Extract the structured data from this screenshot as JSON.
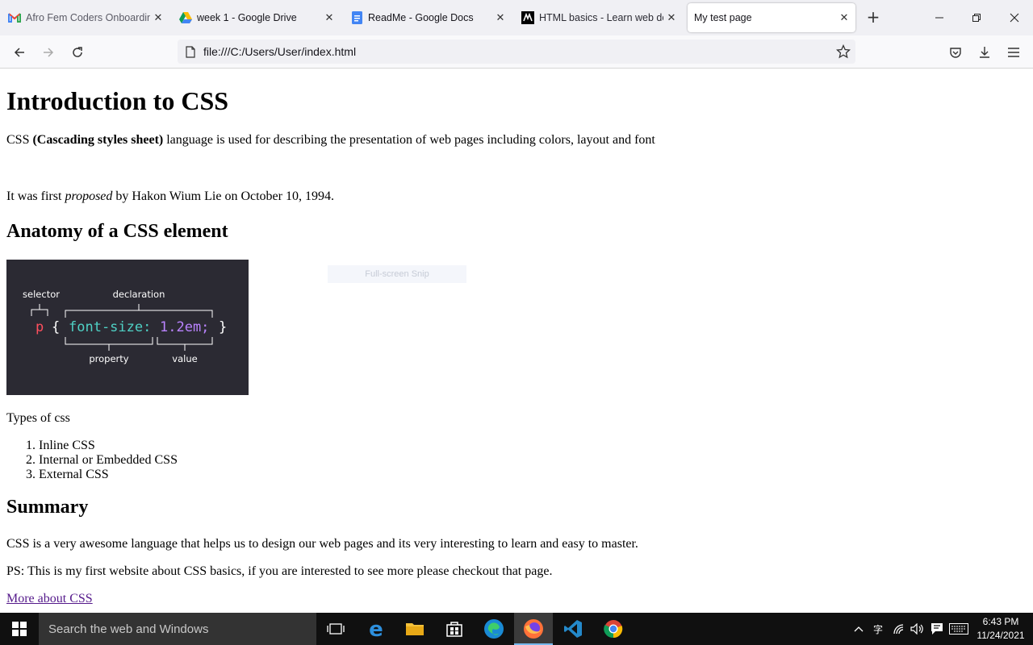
{
  "browser": {
    "tabs": [
      {
        "title": "Afro Fem Coders Onboarding",
        "icon": "gmail-icon",
        "active": false
      },
      {
        "title": "week 1 - Google Drive",
        "icon": "google-drive-icon",
        "active": false
      },
      {
        "title": "ReadMe - Google Docs",
        "icon": "google-docs-icon",
        "active": false
      },
      {
        "title": "HTML basics - Learn web dev",
        "icon": "mdn-icon",
        "active": false
      },
      {
        "title": "My test page",
        "icon": "",
        "active": true
      }
    ],
    "url": "file:///C:/Users/User/index.html"
  },
  "page": {
    "h1": "Introduction to CSS",
    "intro": {
      "prefix": "CSS ",
      "bold": "(Cascading styles sheet)",
      "suffix": " language is used for describing the presentation of web pages including colors, layout and font"
    },
    "history": {
      "prefix": "It was first ",
      "italic": "proposed",
      "suffix": " by Hakon Wium Lie on October 10, 1994."
    },
    "h2_anatomy": "Anatomy of a CSS element",
    "figure": {
      "selector_label": "selector",
      "declaration_label": "declaration",
      "property_label": "property",
      "value_label": "value",
      "code_selector": "p",
      "open_brace": "{",
      "code_property": "font-size:",
      "code_value": "1.2em;",
      "close_brace": "}",
      "colors": {
        "background": "#2b2a33",
        "selector": "#ff4f5e",
        "property": "#4fd1c5",
        "value": "#b983ff",
        "text": "#ffffff"
      }
    },
    "snip_overlay": "Full-screen Snip",
    "types_label": "Types of css",
    "types": [
      "Inline CSS",
      "Internal or Embedded CSS",
      "External CSS"
    ],
    "h2_summary": "Summary",
    "summary": "CSS is a very awesome language that helps us to design our web pages and its very interesting to learn and easy to master.",
    "ps": "PS: This is my first website about CSS basics, if you are interested to see more please checkout that page.",
    "link": "More about CSS"
  },
  "taskbar": {
    "search_placeholder": "Search the web and Windows",
    "time": "6:43 PM",
    "date": "11/24/2021",
    "input_indicator": "字"
  }
}
